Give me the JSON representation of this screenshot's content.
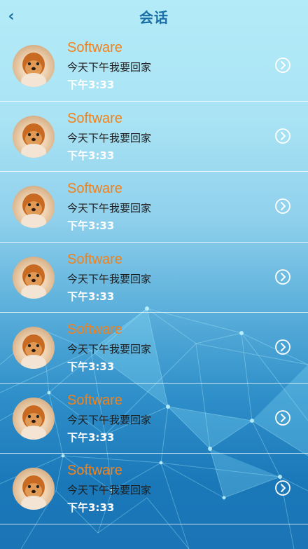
{
  "header": {
    "title": "会话",
    "back_icon": "chevron-left-icon"
  },
  "conversations": [
    {
      "name": "Software",
      "message": "今天下午我要回家",
      "time": "下午3:33",
      "avatar": "dog-avatar",
      "action_icon": "chevron-right-circle-icon"
    },
    {
      "name": "Software",
      "message": "今天下午我要回家",
      "time": "下午3:33",
      "avatar": "dog-avatar",
      "action_icon": "chevron-right-circle-icon"
    },
    {
      "name": "Software",
      "message": "今天下午我要回家",
      "time": "下午3:33",
      "avatar": "dog-avatar",
      "action_icon": "chevron-right-circle-icon"
    },
    {
      "name": "Software",
      "message": "今天下午我要回家",
      "time": "下午3:33",
      "avatar": "dog-avatar",
      "action_icon": "chevron-right-circle-icon"
    },
    {
      "name": "Software",
      "message": "今天下午我要回家",
      "time": "下午3:33",
      "avatar": "dog-avatar",
      "action_icon": "chevron-right-circle-icon"
    },
    {
      "name": "Software",
      "message": "今天下午我要回家",
      "time": "下午3:33",
      "avatar": "dog-avatar",
      "action_icon": "chevron-right-circle-icon"
    },
    {
      "name": "Software",
      "message": "今天下午我要回家",
      "time": "下午3:33",
      "avatar": "dog-avatar",
      "action_icon": "chevron-right-circle-icon"
    }
  ],
  "colors": {
    "title": "#1a6ea3",
    "name": "#f0821e",
    "message": "#1d1d1d",
    "time": "#ffffff"
  }
}
